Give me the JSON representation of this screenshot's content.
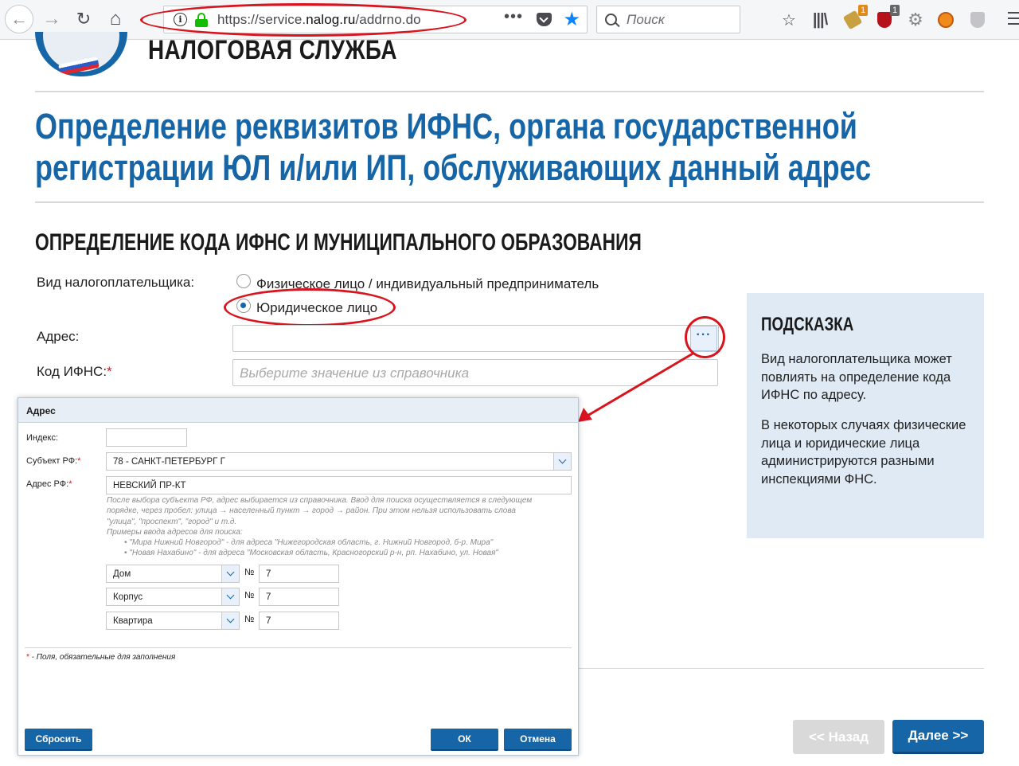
{
  "browser": {
    "url_prefix": "https://service.",
    "url_domain": "nalog.ru",
    "url_path": "/addrno.do",
    "search_placeholder": "Поиск",
    "badges": [
      "1",
      "1"
    ],
    "colors": {
      "accent": "#0a84ff",
      "secure": "#12bc00",
      "annotation": "#d8141f"
    }
  },
  "header": {
    "site_name": "НАЛОГОВАЯ СЛУЖБА"
  },
  "page": {
    "title_line1": "Определение реквизитов ИФНС, органа государственной",
    "title_line2": "регистрации ЮЛ и/или ИП, обслуживающих данный адрес",
    "section_title": "ОПРЕДЕЛЕНИЕ КОДА ИФНС И МУНИЦИПАЛЬНОГО ОБРАЗОВАНИЯ",
    "taxpayer_label": "Вид налогоплательщика:",
    "option_individual": "Физическое лицо / индивидуальный предприниматель",
    "option_legal": "Юридическое лицо",
    "selected_option": "Юридическое лицо",
    "address_label": "Адрес:",
    "address_value": "",
    "dots_label": "···",
    "code_label": "Код ИФНС:",
    "required_mark": "*",
    "code_placeholder": "Выберите значение из справочника",
    "back_button": "<< Назад",
    "next_button": "Далее >>",
    "brand_color": "#1565a7"
  },
  "hint": {
    "title": "ПОДСКАЗКА",
    "paragraph1": "Вид налогоплательщика может повлиять на определение кода ИФНС по адресу.",
    "paragraph2": "В некоторых случаях физические лица и юридические лица администрируются разными инспекциями ФНС."
  },
  "dialog": {
    "title": "Адрес",
    "index_label": "Индекс:",
    "index_value": "",
    "subject_label": "Субъект РФ:",
    "subject_value": "78 - САНКТ-ПЕТЕРБУРГ Г",
    "address_label": "Адрес РФ:",
    "address_value": "НЕВСКИЙ ПР-КТ",
    "help_line1": "После выбора субъекта РФ, адрес выбирается из справочника. Ввод для поиска осуществляется в следующем",
    "help_line2": "порядке, через пробел: улица → населенный пункт → город → район. При этом нельзя использовать слова",
    "help_line3": "\"улица\", \"проспект\", \"город\" и т.д.",
    "help_line4": "Примеры ввода адресов для поиска:",
    "help_ex1": "• \"Мира Нижний Новгород\" - для адреса \"Нижегородская область, г. Нижний Новгород, б-р. Мира\"",
    "help_ex2": "• \"Новая Нахабино\" - для адреса \"Московская область, Красногорский р-н, рп. Нахабино, ул. Новая\"",
    "number_sign": "№",
    "rows": [
      {
        "type": "Дом",
        "number": "7"
      },
      {
        "type": "Корпус",
        "number": "7"
      },
      {
        "type": "Квартира",
        "number": "7"
      }
    ],
    "required_note_mark": "*",
    "required_note": " - Поля, обязательные для заполнения",
    "reset_button": "Сбросить",
    "ok_button": "ОК",
    "cancel_button": "Отмена"
  }
}
